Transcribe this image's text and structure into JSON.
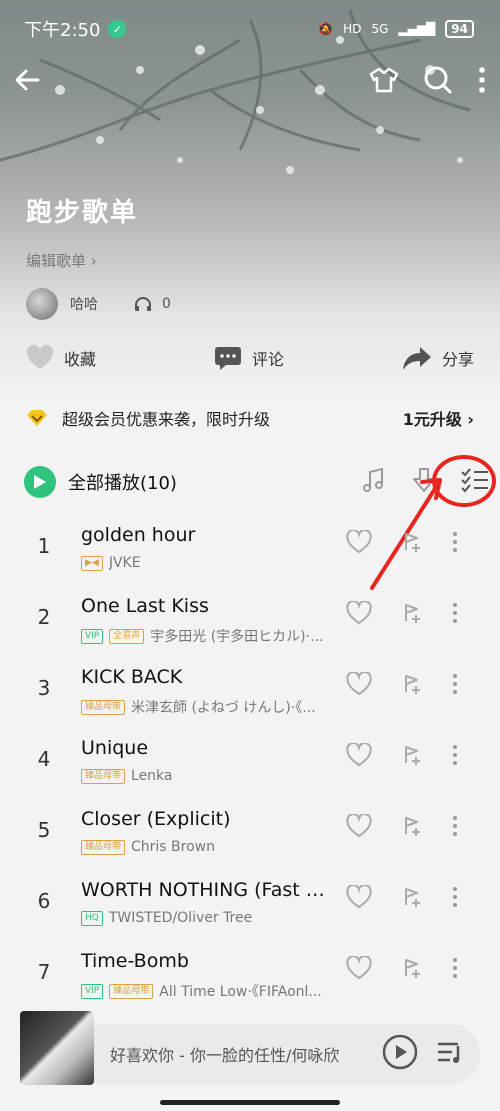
{
  "status_bar": {
    "time": "下午2:50",
    "network": "5G",
    "battery": "94",
    "hd_label": "HD"
  },
  "header": {
    "back_icon": "arrow-left-icon",
    "skin_icon": "tshirt-icon",
    "search_icon": "search-icon",
    "more_icon": "more-vertical-icon"
  },
  "playlist": {
    "title": "跑步歌单",
    "edit_label": "编辑歌单 ›",
    "owner": "哈哈",
    "listen_count": "0"
  },
  "actions": {
    "favorite": "收藏",
    "comment": "评论",
    "share": "分享"
  },
  "vip_banner": {
    "text": "超级会员优惠来袭，限时升级",
    "cta": "1元升级 ›"
  },
  "play_all": {
    "label": "全部播放(10)"
  },
  "songs": [
    {
      "num": "1",
      "title": "golden hour",
      "tags": [],
      "icon_tag": true,
      "artist": "JVKE"
    },
    {
      "num": "2",
      "title": "One Last Kiss",
      "tags": [
        "VIP",
        "全景声"
      ],
      "artist": "宇多田光 (宇多田ヒカル)·..."
    },
    {
      "num": "3",
      "title": "KICK BACK",
      "tags": [
        "臻品母带"
      ],
      "artist": "米津玄師 (よねづ けんし)·《..."
    },
    {
      "num": "4",
      "title": "Unique",
      "tags": [
        "臻品母带"
      ],
      "artist": "Lenka"
    },
    {
      "num": "5",
      "title": "Closer (Explicit)",
      "tags": [
        "臻品母带"
      ],
      "artist": "Chris Brown"
    },
    {
      "num": "6",
      "title": "WORTH NOTHING (Fast &...",
      "tags": [
        "HQ"
      ],
      "artist": "TWISTED/Oliver Tree"
    },
    {
      "num": "7",
      "title": "Time-Bomb",
      "tags": [
        "VIP",
        "臻品母带"
      ],
      "artist": "All Time Low·《FIFAonl..."
    }
  ],
  "mini_player": {
    "track": "好喜欢你 - 你一脸的任性/何咏欣"
  },
  "colors": {
    "accent": "#31c27c",
    "highlight": "#e8251f",
    "gold": "#d8a14a"
  }
}
